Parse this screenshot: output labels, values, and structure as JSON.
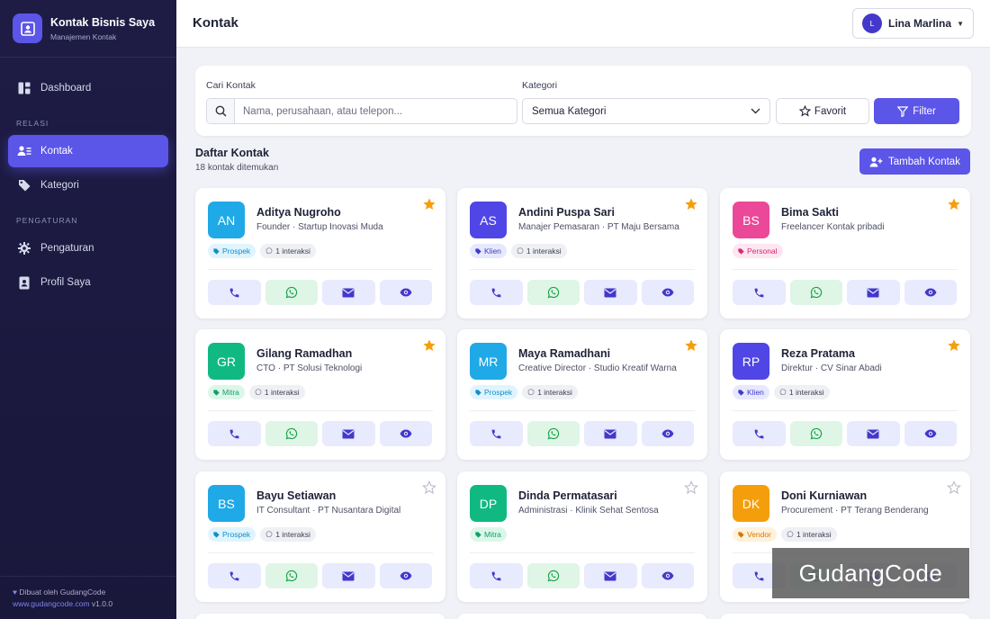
{
  "brand": {
    "title": "Kontak Bisnis Saya",
    "subtitle": "Manajemen Kontak"
  },
  "sidebar": {
    "dashboard": "Dashboard",
    "section_relasi": "RELASI",
    "kontak": "Kontak",
    "kategori": "Kategori",
    "section_pengaturan": "PENGATURAN",
    "pengaturan": "Pengaturan",
    "profil": "Profil Saya",
    "footer_made_by": "Dibuat oleh GudangCode",
    "footer_link": "www.gudangcode.com",
    "footer_version": "v1.0.0"
  },
  "header": {
    "title": "Kontak",
    "user_initial": "L",
    "user_name": "Lina Marlina"
  },
  "search": {
    "label": "Cari Kontak",
    "placeholder": "Nama, perusahaan, atau telepon...",
    "category_label": "Kategori",
    "category_value": "Semua Kategori",
    "favorite_label": "Favorit",
    "filter_label": "Filter"
  },
  "list": {
    "title": "Daftar Kontak",
    "count": "18 kontak ditemukan",
    "add_label": "Tambah Kontak"
  },
  "colors": {
    "accent": "#5b55e8",
    "star": "#f59e0b"
  },
  "contacts": [
    {
      "initials": "AN",
      "name": "Aditya Nugroho",
      "meta": "Founder · Startup Inovasi Muda",
      "category": "Prospek",
      "interactions": "1 interaksi",
      "favorite": true,
      "avatar_color": "#1fa9e6"
    },
    {
      "initials": "AS",
      "name": "Andini Puspa Sari",
      "meta": "Manajer Pemasaran · PT Maju Bersama",
      "category": "Klien",
      "interactions": "1 interaksi",
      "favorite": true,
      "avatar_color": "#4f46e5"
    },
    {
      "initials": "BS",
      "name": "Bima Sakti",
      "meta": "Freelancer Kontak pribadi",
      "category": "Personal",
      "interactions": "",
      "favorite": true,
      "avatar_color": "#ec4899"
    },
    {
      "initials": "GR",
      "name": "Gilang Ramadhan",
      "meta": "CTO · PT Solusi Teknologi",
      "category": "Mitra",
      "interactions": "1 interaksi",
      "favorite": true,
      "avatar_color": "#10b981"
    },
    {
      "initials": "MR",
      "name": "Maya Ramadhani",
      "meta": "Creative Director · Studio Kreatif Warna",
      "category": "Prospek",
      "interactions": "1 interaksi",
      "favorite": true,
      "avatar_color": "#1fa9e6"
    },
    {
      "initials": "RP",
      "name": "Reza Pratama",
      "meta": "Direktur · CV Sinar Abadi",
      "category": "Klien",
      "interactions": "1 interaksi",
      "favorite": true,
      "avatar_color": "#4f46e5"
    },
    {
      "initials": "BS",
      "name": "Bayu Setiawan",
      "meta": "IT Consultant · PT Nusantara Digital",
      "category": "Prospek",
      "interactions": "1 interaksi",
      "favorite": false,
      "avatar_color": "#1fa9e6"
    },
    {
      "initials": "DP",
      "name": "Dinda Permatasari",
      "meta": "Administrasi · Klinik Sehat Sentosa",
      "category": "Mitra",
      "interactions": "",
      "favorite": false,
      "avatar_color": "#10b981"
    },
    {
      "initials": "DK",
      "name": "Doni Kurniawan",
      "meta": "Procurement · PT Terang Benderang",
      "category": "Vendor",
      "interactions": "1 interaksi",
      "favorite": false,
      "avatar_color": "#f59e0b"
    }
  ],
  "category_styles": {
    "Prospek": {
      "bg": "#e0f4fd",
      "fg": "#0e8fcb"
    },
    "Klien": {
      "bg": "#e6e8fd",
      "fg": "#4338ca"
    },
    "Personal": {
      "bg": "#fde6f1",
      "fg": "#db2777"
    },
    "Mitra": {
      "bg": "#dcf7ea",
      "fg": "#0f9f6e"
    },
    "Vendor": {
      "bg": "#fef2dc",
      "fg": "#d97706"
    }
  },
  "watermark": "GudangCode"
}
